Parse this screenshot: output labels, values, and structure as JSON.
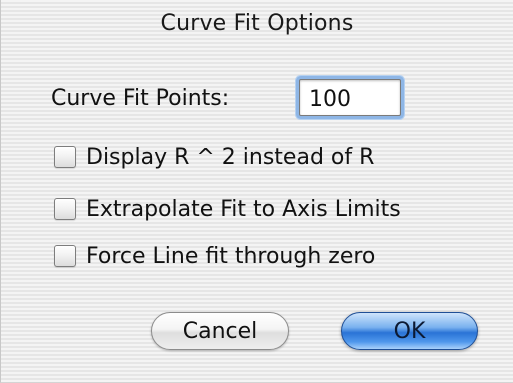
{
  "dialog": {
    "title": "Curve Fit Options"
  },
  "curve_fit_points": {
    "label": "Curve Fit Points:",
    "value": "100"
  },
  "options": [
    {
      "label": "Display R ^ 2 instead of R",
      "checked": false
    },
    {
      "label": "Extrapolate Fit to Axis Limits",
      "checked": false
    },
    {
      "label": "Force Line fit through zero",
      "checked": false
    }
  ],
  "buttons": {
    "cancel_label": "Cancel",
    "ok_label": "OK"
  },
  "colors": {
    "default_button": "#2a73d6",
    "focus_ring": "#8eb6e6"
  }
}
